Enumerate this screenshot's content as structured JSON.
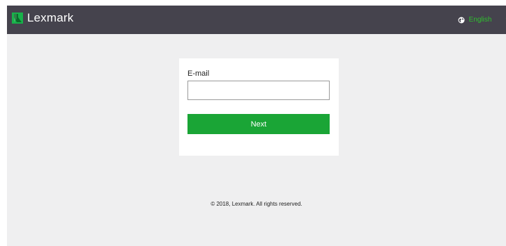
{
  "header": {
    "brand_name": "Lexmark",
    "brand_color": "#18b24a",
    "language": "English",
    "language_caret": "▾",
    "globe_icon": "globe-icon"
  },
  "login": {
    "email_label": "E-mail",
    "email_value": "",
    "email_placeholder": "",
    "next_label": "Next"
  },
  "footer": {
    "copyright": "© 2018, Lexmark. All rights reserved."
  },
  "colors": {
    "header_bg": "#45434d",
    "page_bg": "#efeff0",
    "accent_green": "#1aa536"
  }
}
